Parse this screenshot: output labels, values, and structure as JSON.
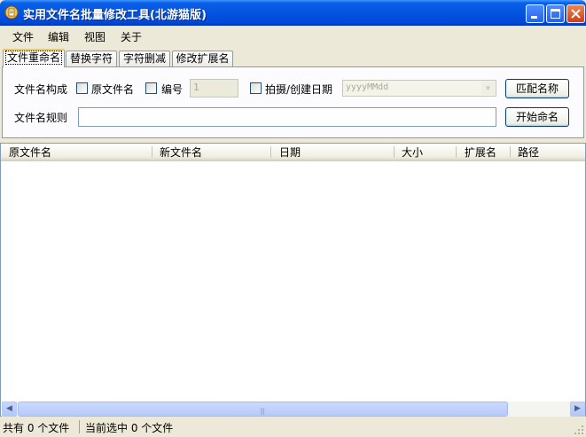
{
  "window": {
    "title": "实用文件名批量修改工具(北游猫版)",
    "accent": "#0454e0"
  },
  "menu": {
    "items": [
      "文件",
      "编辑",
      "视图",
      "关于"
    ]
  },
  "tabs": [
    {
      "label": "文件重命名",
      "active": true
    },
    {
      "label": "替换字符",
      "active": false
    },
    {
      "label": "字符删减",
      "active": false
    },
    {
      "label": "修改扩展名",
      "active": false
    }
  ],
  "rename_panel": {
    "composition_label": "文件名构成",
    "original_name_label": "原文件名",
    "number_label": "编号",
    "number_value": "1",
    "date_label": "拍摄/创建日期",
    "date_format_value": "yyyyMMdd",
    "match_button": "匹配名称",
    "rule_label": "文件名规则",
    "rule_value": "",
    "start_button": "开始命名"
  },
  "list": {
    "columns": [
      "原文件名",
      "新文件名",
      "日期",
      "大小",
      "扩展名",
      "路径"
    ],
    "rows": []
  },
  "status": {
    "total_text": "共有 0 个文件",
    "selected_text": "当前选中 0 个文件"
  }
}
